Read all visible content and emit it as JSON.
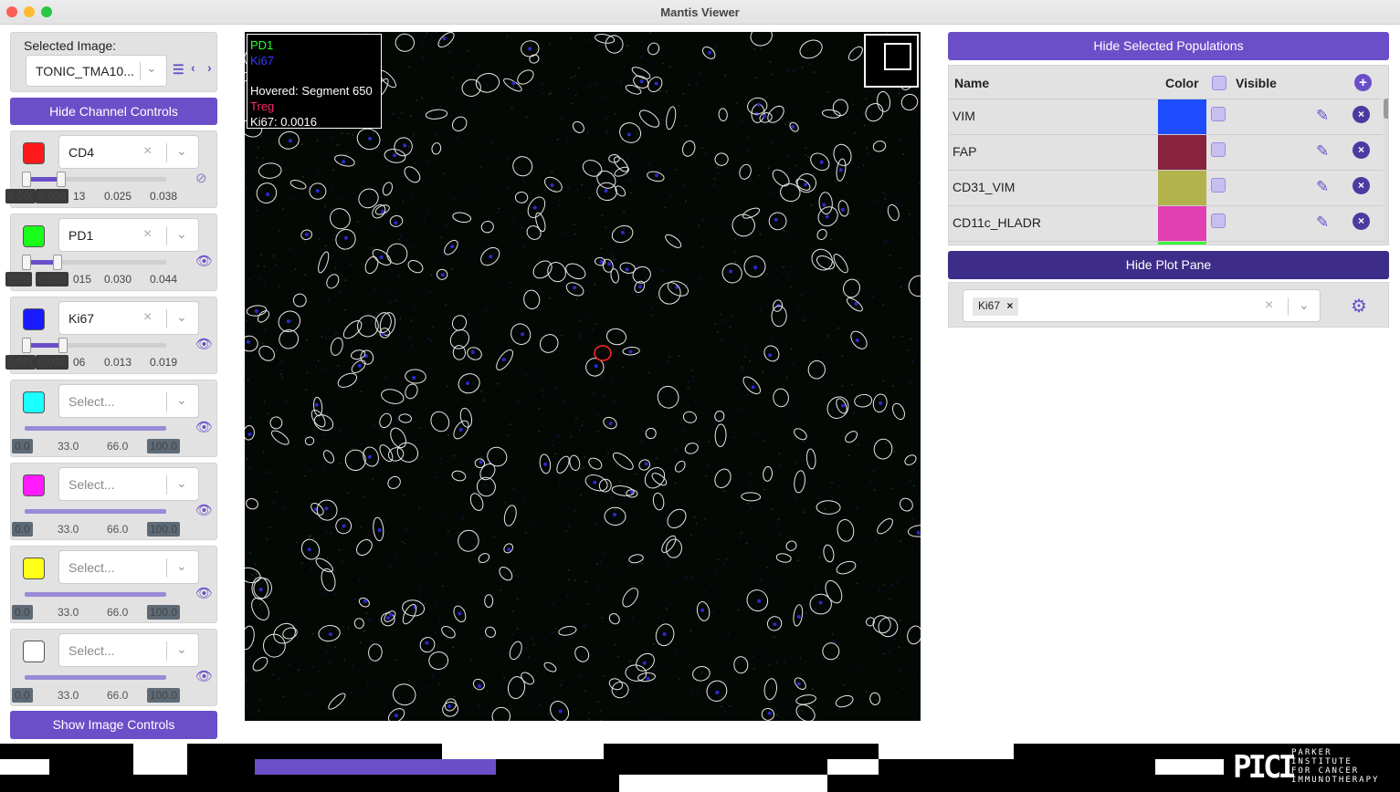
{
  "window": {
    "title": "Mantis Viewer"
  },
  "image_selector": {
    "label": "Selected Image:",
    "value": "TONIC_TMA10..."
  },
  "buttons": {
    "hide_channel_controls": "Hide Channel Controls",
    "show_image_controls": "Show Image Controls",
    "hide_selected_populations": "Hide Selected Populations",
    "hide_plot_pane": "Hide Plot Pane"
  },
  "channels": [
    {
      "color": "#ff1a1a",
      "marker": "CD4",
      "ticks": [
        "0.00(",
        "0.008",
        "13",
        "0.025",
        "0.038"
      ],
      "min": 0.0,
      "max": 0.008,
      "visible": false
    },
    {
      "color": "#1aff1a",
      "marker": "PD1",
      "ticks": [
        "0.00",
        "0.008",
        "015",
        "0.030",
        "0.044"
      ],
      "min": 0.0,
      "max": 0.008,
      "visible": true
    },
    {
      "color": "#1a1aff",
      "marker": "Ki67",
      "ticks": [
        "0.00(",
        "0.004",
        "06",
        "0.013",
        "0.019"
      ],
      "min": 0.0,
      "max": 0.004,
      "visible": true
    },
    {
      "color": "#1affff",
      "placeholder": "Select...",
      "ticks": [
        "0.0",
        "33.0",
        "66.0",
        "100.0"
      ],
      "visible": true
    },
    {
      "color": "#ff1aff",
      "placeholder": "Select...",
      "ticks": [
        "0.0",
        "33.0",
        "66.0",
        "100.0"
      ],
      "visible": true
    },
    {
      "color": "#ffff1a",
      "placeholder": "Select...",
      "ticks": [
        "0.0",
        "33.0",
        "66.0",
        "100.0"
      ],
      "visible": true
    },
    {
      "color": "#ffffff",
      "placeholder": "Select...",
      "ticks": [
        "0.0",
        "33.0",
        "66.0",
        "100.0"
      ],
      "visible": true
    }
  ],
  "viewer": {
    "legend": {
      "channel1": "PD1",
      "channel2": "Ki67",
      "hovered": "Hovered: Segment 650",
      "population": "Treg",
      "value": "Ki67: 0.0016"
    }
  },
  "populations": {
    "headers": {
      "name": "Name",
      "color": "Color",
      "visible": "Visible"
    },
    "rows": [
      {
        "name": "VIM",
        "color": "#1e4cff"
      },
      {
        "name": "FAP",
        "color": "#87223f"
      },
      {
        "name": "CD31_VIM",
        "color": "#b3b34d"
      },
      {
        "name": "CD11c_HLADR",
        "color": "#e23fb3"
      }
    ]
  },
  "plot": {
    "selected_marker": "Ki67"
  },
  "branding": {
    "org_line1": "PARKER",
    "org_line2": "INSTITUTE",
    "org_line3": "FOR CANCER",
    "org_line4": "IMMUNOTHERAPY"
  },
  "colors": {
    "accent": "#6b4fc8"
  }
}
